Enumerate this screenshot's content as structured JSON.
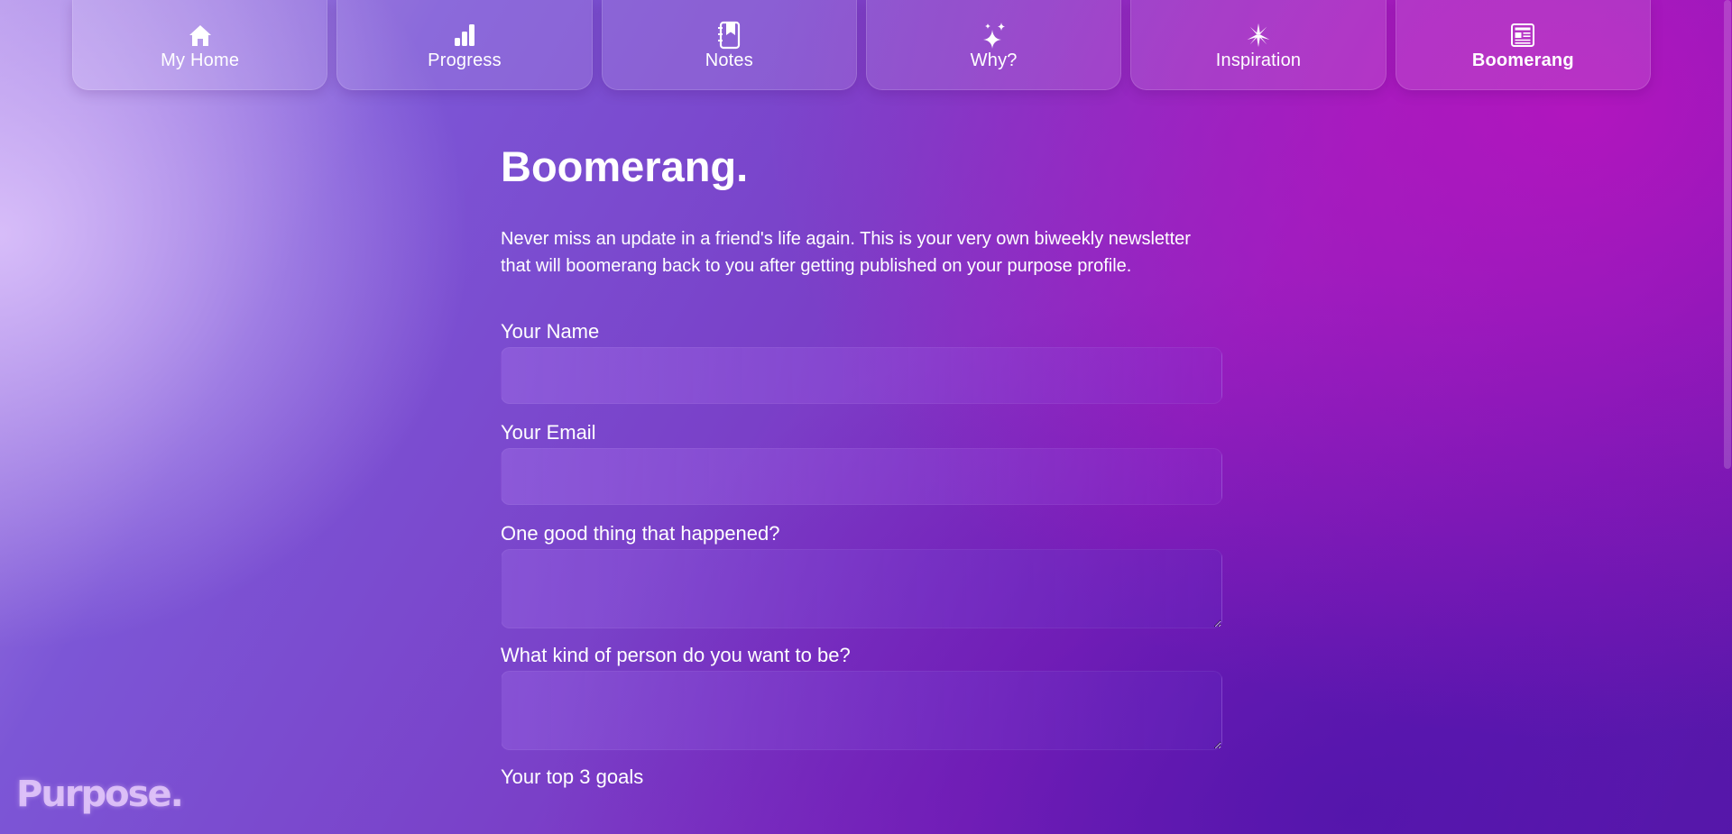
{
  "nav": {
    "items": [
      {
        "label": "My Home",
        "icon": "home-icon",
        "active": false
      },
      {
        "label": "Progress",
        "icon": "bar-chart-icon",
        "active": false
      },
      {
        "label": "Notes",
        "icon": "notebook-icon",
        "active": false
      },
      {
        "label": "Why?",
        "icon": "sparkles-icon",
        "active": false
      },
      {
        "label": "Inspiration",
        "icon": "star-burst-icon",
        "active": false
      },
      {
        "label": "Boomerang",
        "icon": "newspaper-icon",
        "active": true
      }
    ]
  },
  "page": {
    "title": "Boomerang.",
    "intro": "Never miss an update in a friend's life again. This is your very own biweekly newsletter that will boomerang back to you after getting published on your purpose profile."
  },
  "form": {
    "name": {
      "label": "Your Name",
      "value": "",
      "placeholder": ""
    },
    "email": {
      "label": "Your Email",
      "value": "",
      "placeholder": ""
    },
    "good_thing": {
      "label": "One good thing that happened?",
      "value": "",
      "placeholder": ""
    },
    "person": {
      "label": "What kind of person do you want to be?",
      "value": "",
      "placeholder": ""
    },
    "goals": {
      "label": "Your top 3 goals"
    }
  },
  "brand": {
    "logo_text": "Purpose."
  },
  "colors": {
    "text": "#ffffff",
    "accent_magenta": "#b414be",
    "accent_purple": "#7a40c8"
  }
}
